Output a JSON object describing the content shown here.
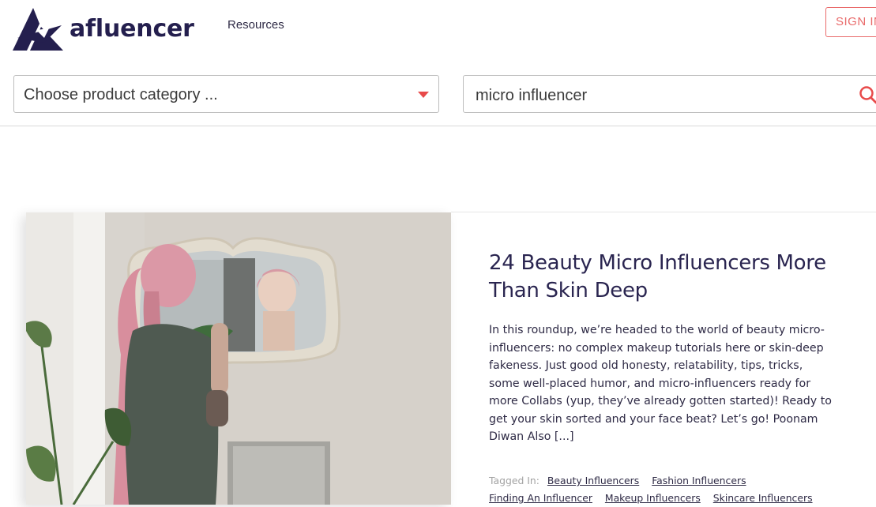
{
  "brand": {
    "name": "afluencer",
    "colors": {
      "primary": "#241f4e",
      "accent": "#e84a4a"
    }
  },
  "nav": {
    "resources_label": "Resources",
    "signin_label": "SIGN IN"
  },
  "filters": {
    "category_placeholder": "Choose product category ...",
    "search_value": "micro influencer"
  },
  "article": {
    "title": "24 Beauty Micro Influencers More Than Skin Deep",
    "excerpt": "In this roundup, we’re headed to the world of beauty micro-influencers: no complex makeup tutorials here or skin-deep fakeness. Just good old honesty, relatability, tips, tricks, some well-placed humor, and micro-influencers ready for more Collabs (yup, they’ve already gotten started)! Ready to get your skin sorted and your face beat? Let’s go! Poonam Diwan Also [...]",
    "tagged_label": "Tagged In:",
    "tags": [
      "Beauty Influencers",
      "Fashion Influencers",
      "Finding An Influencer",
      "Makeup Influencers",
      "Skincare Influencers"
    ]
  }
}
